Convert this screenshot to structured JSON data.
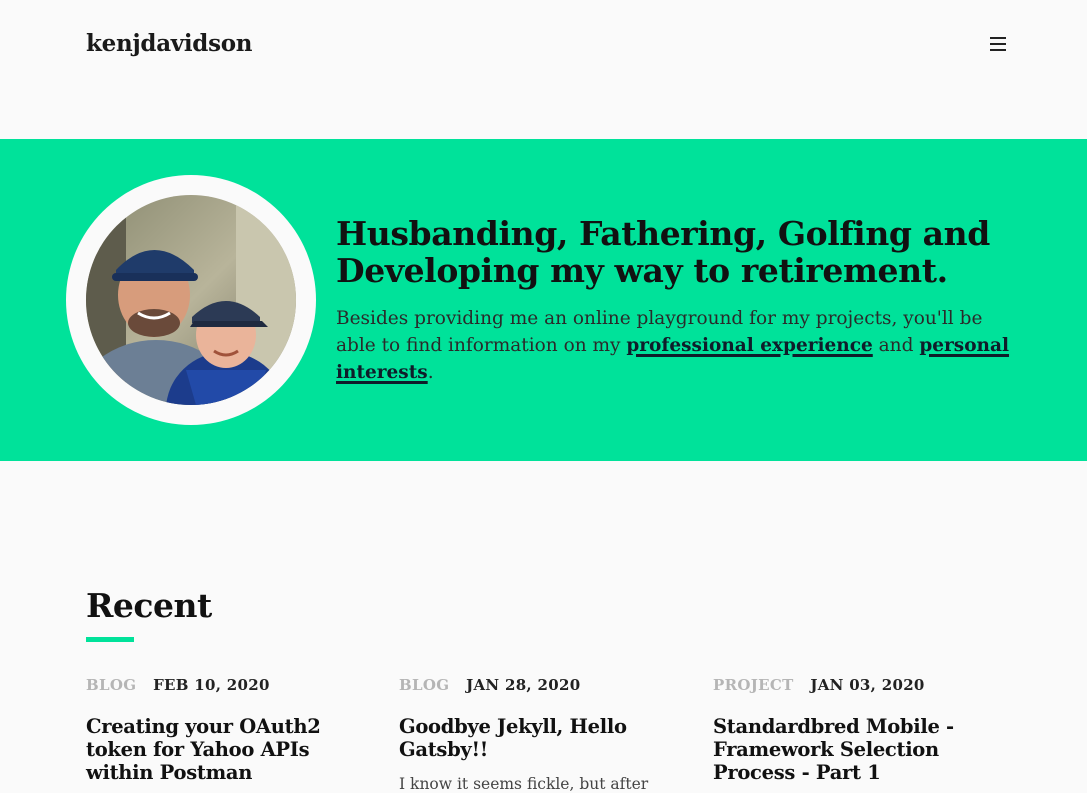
{
  "header": {
    "brand": "kenjdavidson",
    "menu_icon": "hamburger-menu-icon"
  },
  "hero": {
    "avatar_alt": "Photo of father and son",
    "title": "Husbanding, Fathering, Golfing and Developing my way to retirement.",
    "text_before": "Besides providing me an online playground for my projects, you'll be able to find information on my ",
    "link_professional": "professional experience",
    "text_and": " and ",
    "link_personal": "personal interests",
    "text_after": ".",
    "colors": {
      "background": "#00e29a",
      "link": "#0f1d2a"
    }
  },
  "recent": {
    "heading": "Recent",
    "cards": [
      {
        "category": "BLOG",
        "date": "FEB 10, 2020",
        "title": "Creating your OAuth2 token for Yahoo APIs within Postman",
        "excerpt": ""
      },
      {
        "category": "BLOG",
        "date": "JAN 28, 2020",
        "title": "Goodbye Jekyll, Hello Gatsby!!",
        "excerpt": "I know it seems fickle, but after"
      },
      {
        "category": "PROJECT",
        "date": "JAN 03, 2020",
        "title": "Standardbred Mobile - Framework Selection Process - Part 1",
        "excerpt": ""
      }
    ]
  }
}
